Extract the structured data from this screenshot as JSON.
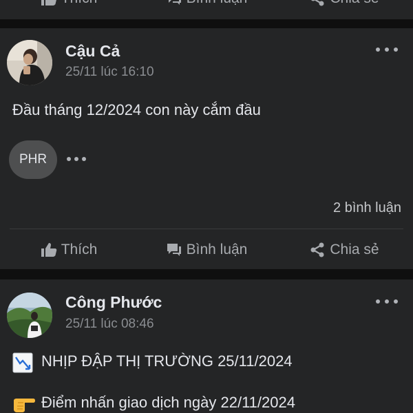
{
  "actions": {
    "like": "Thích",
    "comment": "Bình luận",
    "share": "Chia sẻ"
  },
  "posts": [
    {
      "author": "Cậu Cả",
      "timestamp": "25/11 lúc 16:10",
      "text": "Đầu tháng 12/2024 con này cắm đầu",
      "reactor_chip": "PHR",
      "comments_count": "2 bình luận"
    },
    {
      "author": "Công Phước",
      "timestamp": "25/11 lúc 08:46",
      "line1": "NHỊP ĐẬP THỊ TRƯỜNG 25/11/2024",
      "line1_icon": "chart-decreasing-emoji",
      "line2": "Điểm nhấn giao dịch ngày 22/11/2024",
      "line2_icon": "pointing-right-emoji"
    }
  ],
  "colors": {
    "card_bg": "#242526",
    "feed_bg": "#0f0f0f",
    "primary_text": "#e4e6eb",
    "secondary_text": "#8a8d91",
    "action_text": "#a8abaf"
  }
}
